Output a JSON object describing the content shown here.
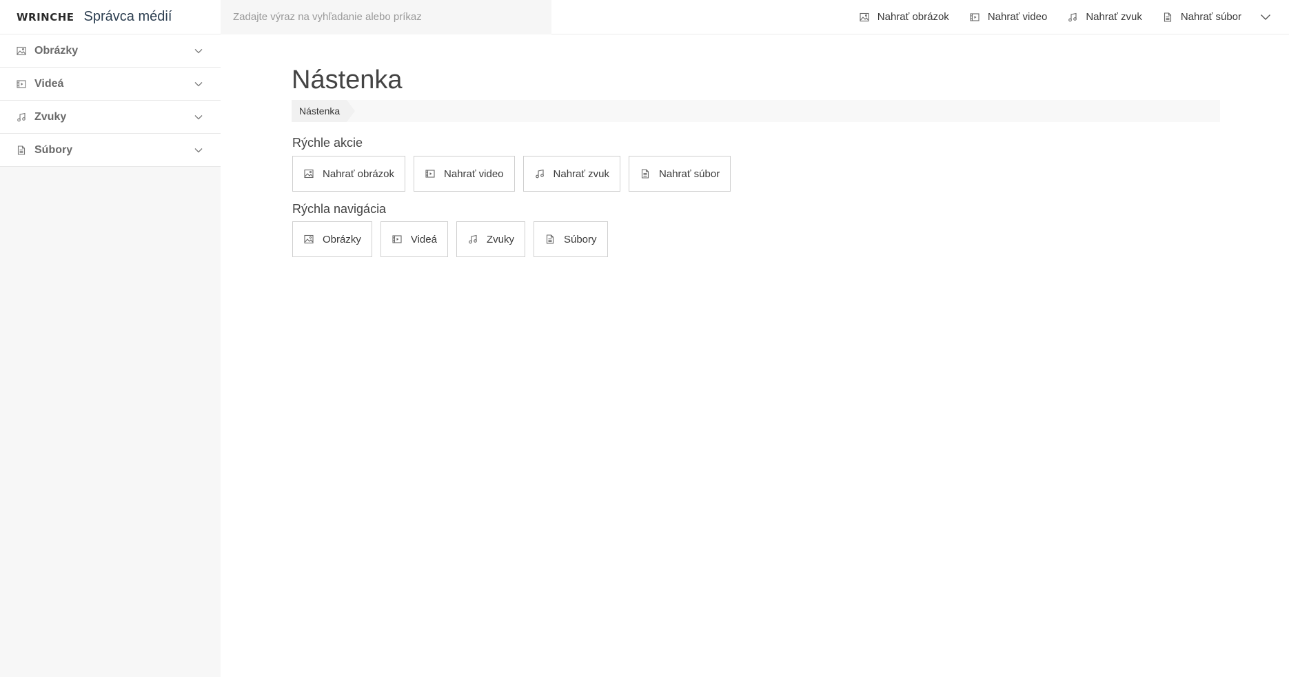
{
  "brand": {
    "logo": "WRINCHE",
    "title": "Správca médií"
  },
  "search": {
    "placeholder": "Zadajte výraz na vyhľadanie alebo príkaz",
    "value": ""
  },
  "top_actions": [
    {
      "label": "Nahrať obrázok",
      "icon": "image-icon"
    },
    {
      "label": "Nahrať video",
      "icon": "film-icon"
    },
    {
      "label": "Nahrať zvuk",
      "icon": "music-icon"
    },
    {
      "label": "Nahrať súbor",
      "icon": "file-icon"
    }
  ],
  "sidebar": {
    "items": [
      {
        "label": "Obrázky",
        "icon": "image-icon"
      },
      {
        "label": "Videá",
        "icon": "film-icon"
      },
      {
        "label": "Zvuky",
        "icon": "music-icon"
      },
      {
        "label": "Súbory",
        "icon": "file-icon"
      }
    ]
  },
  "main": {
    "title": "Nástenka",
    "breadcrumb": [
      "Nástenka"
    ],
    "quick_actions": {
      "title": "Rýchle akcie",
      "buttons": [
        {
          "label": "Nahrať obrázok",
          "icon": "image-icon"
        },
        {
          "label": "Nahrať video",
          "icon": "film-icon"
        },
        {
          "label": "Nahrať zvuk",
          "icon": "music-icon"
        },
        {
          "label": "Nahrať súbor",
          "icon": "file-icon"
        }
      ]
    },
    "quick_nav": {
      "title": "Rýchla navigácia",
      "buttons": [
        {
          "label": "Obrázky",
          "icon": "image-icon"
        },
        {
          "label": "Videá",
          "icon": "film-icon"
        },
        {
          "label": "Zvuky",
          "icon": "music-icon"
        },
        {
          "label": "Súbory",
          "icon": "file-icon"
        }
      ]
    }
  },
  "colors": {
    "sidebar_bg": "#f7f7f7",
    "search_bg": "#f6f6f6",
    "brand_title": "#2c3e50",
    "border": "#cfcfcf"
  }
}
